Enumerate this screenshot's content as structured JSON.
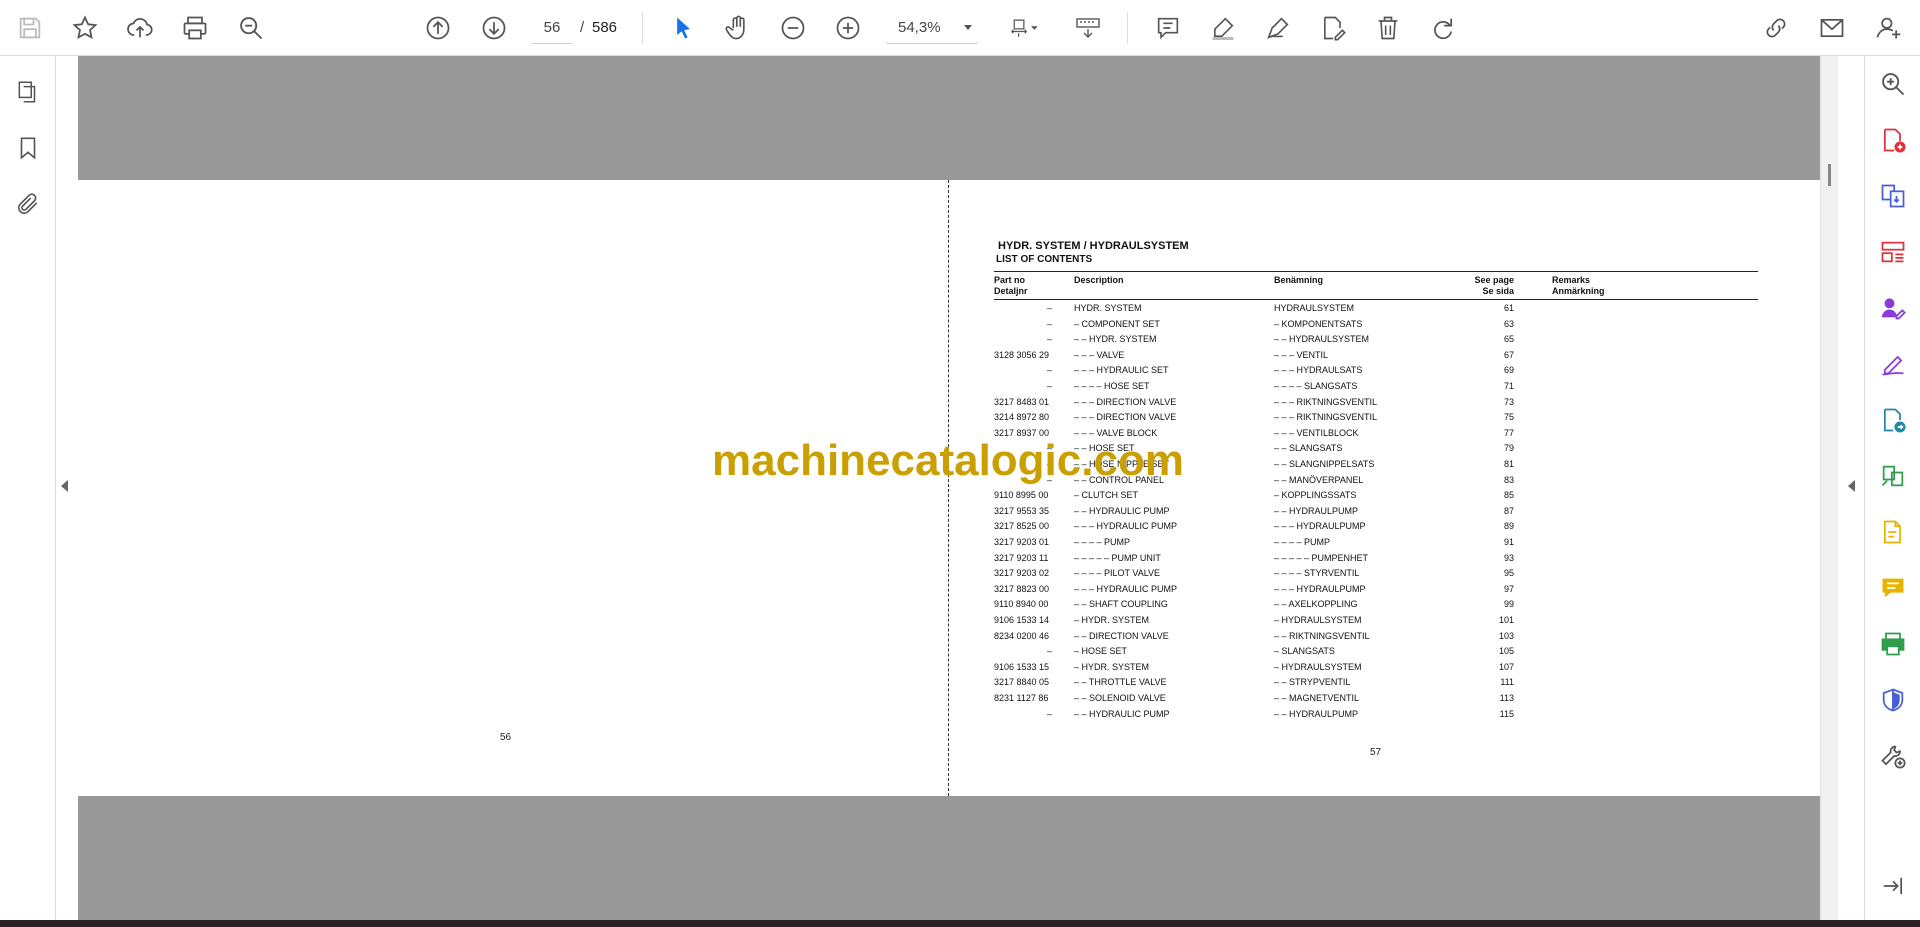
{
  "toolbar": {
    "current_page": "56",
    "page_separator": "/",
    "total_pages": "586",
    "zoom": "54,3%"
  },
  "document": {
    "left_page_number": "56",
    "right_page_number": "57",
    "title": "HYDR. SYSTEM  / HYDRAULSYSTEM",
    "subtitle": "LIST OF CONTENTS",
    "headers": {
      "part_no": "Part no",
      "part_no_sv": "Detaljnr",
      "description": "Description",
      "benamning": "Benämning",
      "see_page": "See page",
      "se_sida": "Se sida",
      "remarks": "Remarks",
      "anmarkning": "Anmärkning"
    },
    "rows": [
      {
        "part": "–",
        "desc": "HYDR. SYSTEM",
        "ben": "HYDRAULSYSTEM",
        "page": "61"
      },
      {
        "part": "–",
        "desc": "– COMPONENT SET",
        "ben": "– KOMPONENTSATS",
        "page": "63"
      },
      {
        "part": "–",
        "desc": "– – HYDR. SYSTEM",
        "ben": "– – HYDRAULSYSTEM",
        "page": "65"
      },
      {
        "part": "3128 3056 29",
        "desc": "– – – VALVE",
        "ben": "– – – VENTIL",
        "page": "67"
      },
      {
        "part": "–",
        "desc": "– – – HYDRAULIC SET",
        "ben": "– – – HYDRAULSATS",
        "page": "69"
      },
      {
        "part": "–",
        "desc": "– – – – HOSE SET",
        "ben": "– – – – SLANGSATS",
        "page": "71"
      },
      {
        "part": "3217 8483 01",
        "desc": "– – – DIRECTION VALVE",
        "ben": "– – – RIKTNINGSVENTIL",
        "page": "73"
      },
      {
        "part": "3214 8972 80",
        "desc": "– – – DIRECTION VALVE",
        "ben": "– – – RIKTNINGSVENTIL",
        "page": "75"
      },
      {
        "part": "3217 8937 00",
        "desc": "– – – VALVE BLOCK",
        "ben": "– – – VENTILBLOCK",
        "page": "77"
      },
      {
        "part": "–",
        "desc": "– – HOSE SET",
        "ben": "– – SLANGSATS",
        "page": "79"
      },
      {
        "part": "–",
        "desc": "– – HOSE NIPPLE SET",
        "ben": "– – SLANGNIPPELSATS",
        "page": "81"
      },
      {
        "part": "–",
        "desc": "– – CONTROL PANEL",
        "ben": "– – MANÖVERPANEL",
        "page": "83"
      },
      {
        "part": "9110 8995 00",
        "desc": "– CLUTCH SET",
        "ben": "– KOPPLINGSSATS",
        "page": "85"
      },
      {
        "part": "3217 9553 35",
        "desc": "– – HYDRAULIC PUMP",
        "ben": "– – HYDRAULPUMP",
        "page": "87"
      },
      {
        "part": "3217 8525 00",
        "desc": "– – – HYDRAULIC PUMP",
        "ben": "– – – HYDRAULPUMP",
        "page": "89"
      },
      {
        "part": "3217 9203 01",
        "desc": "– – – – PUMP",
        "ben": "– – – – PUMP",
        "page": "91"
      },
      {
        "part": "3217 9203 11",
        "desc": "– – – – – PUMP UNIT",
        "ben": "– – – – – PUMPENHET",
        "page": "93"
      },
      {
        "part": "3217 9203 02",
        "desc": "– – – – PILOT VALVE",
        "ben": "– – – – STYRVENTIL",
        "page": "95"
      },
      {
        "part": "3217 8823 00",
        "desc": "– – – HYDRAULIC PUMP",
        "ben": "– – – HYDRAULPUMP",
        "page": "97"
      },
      {
        "part": "9110 8940 00",
        "desc": "– – SHAFT COUPLING",
        "ben": "– – AXELKOPPLING",
        "page": "99"
      },
      {
        "part": "9106 1533 14",
        "desc": "– HYDR. SYSTEM",
        "ben": "– HYDRAULSYSTEM",
        "page": "101"
      },
      {
        "part": "8234 0200 46",
        "desc": "– – DIRECTION VALVE",
        "ben": "– – RIKTNINGSVENTIL",
        "page": "103"
      },
      {
        "part": "–",
        "desc": "– HOSE SET",
        "ben": "– SLANGSATS",
        "page": "105"
      },
      {
        "part": "9106 1533 15",
        "desc": "– HYDR. SYSTEM",
        "ben": "– HYDRAULSYSTEM",
        "page": "107"
      },
      {
        "part": "3217 8840 05",
        "desc": "– – THROTTLE VALVE",
        "ben": "– – STRYPVENTIL",
        "page": "111"
      },
      {
        "part": "8231 1127 86",
        "desc": "– – SOLENOID VALVE",
        "ben": "– – MAGNETVENTIL",
        "page": "113"
      },
      {
        "part": "–",
        "desc": "– – HYDRAULIC PUMP",
        "ben": "– – HYDRAULPUMP",
        "page": "115"
      }
    ]
  },
  "watermark": "machinecatalogic.com",
  "colors": {
    "accent_blue": "#1473e6",
    "watermark_gold": "#c9a000",
    "export_red": "#e0313c",
    "organize_purple": "#8d3bd8",
    "comment_yellow": "#e8b400",
    "print_green": "#2f9d4b",
    "protect_blue": "#4a5fd7"
  }
}
